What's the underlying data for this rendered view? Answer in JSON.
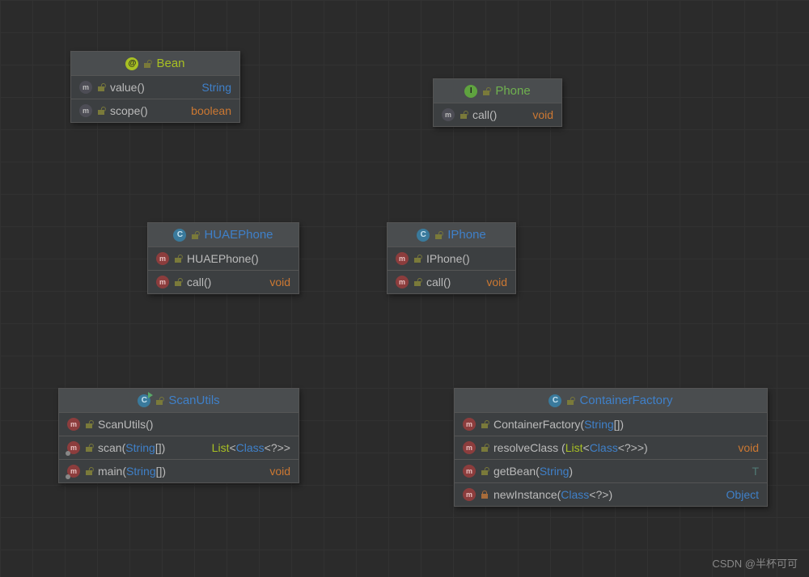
{
  "watermark": "CSDN @半杯可可",
  "nodes": {
    "bean": {
      "title": "Bean",
      "members": [
        {
          "name": "value()",
          "rtype": "String",
          "rclass": "t-str"
        },
        {
          "name": "scope()",
          "rtype": "boolean",
          "rclass": "t-bool"
        }
      ]
    },
    "phone": {
      "title": "Phone",
      "members": [
        {
          "name": "call()",
          "rtype": "void",
          "rclass": "t-void"
        }
      ]
    },
    "huae": {
      "title": "HUAEPhone",
      "members": [
        {
          "name": "HUAEPhone()",
          "rtype": "",
          "rclass": ""
        },
        {
          "name": "call()",
          "rtype": "void",
          "rclass": "t-void"
        }
      ]
    },
    "iphone": {
      "title": "IPhone",
      "members": [
        {
          "name": "IPhone()",
          "rtype": "",
          "rclass": ""
        },
        {
          "name": "call()",
          "rtype": "void",
          "rclass": "t-void"
        }
      ]
    },
    "scan": {
      "title": "ScanUtils",
      "members": [
        {
          "name": "ScanUtils()"
        },
        {
          "name": "scan",
          "p1t": "String",
          "p1s": "[]",
          "rpre": "List",
          "rgen": "Class",
          "rwild": "<?>>"
        },
        {
          "name": "main",
          "p1t": "String",
          "p1s": "[]",
          "rtype": "void",
          "rclass": "t-void"
        }
      ]
    },
    "factory": {
      "title": "ContainerFactory",
      "members": [
        {
          "name": "ContainerFactory",
          "p1t": "String",
          "p1s": "[]"
        },
        {
          "name": "resolveClass ",
          "p1pre": "List",
          "p1gen": "Class",
          "p1wild": "<?>>",
          "rtype": "void",
          "rclass": "t-void"
        },
        {
          "name": "getBean",
          "p1t": "String",
          "p1s": "",
          "rtype": "T",
          "rclass": "t-tvar"
        },
        {
          "name": "newInstance",
          "p1gen": "Class",
          "p1wild": "<?>",
          "rtype": "Object",
          "rclass": "t-obj"
        }
      ]
    }
  }
}
